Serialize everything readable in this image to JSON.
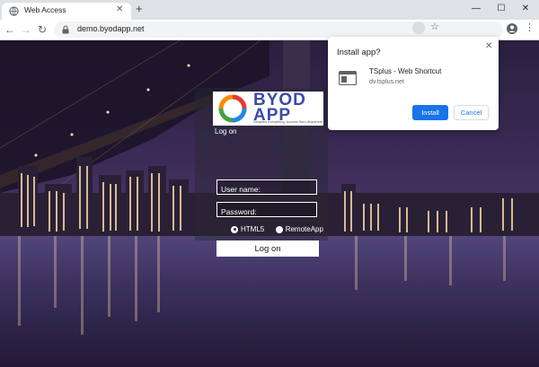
{
  "browser": {
    "tab_title": "Web Access",
    "url": "demo.byodapp.net"
  },
  "install_popup": {
    "title": "Install app?",
    "app_name": "TSplus - Web Shortcut",
    "app_url": "dv.tsplus.net",
    "install_label": "Install",
    "cancel_label": "Cancel"
  },
  "login": {
    "logo_text": "BYOD APP",
    "logo_tagline": "Simplies everything. Access from Anywhere",
    "section_label": "Log on",
    "username_placeholder": "User name:",
    "password_placeholder": "Password:",
    "mode_options": [
      "HTML5",
      "RemoteApp"
    ],
    "selected_mode": "HTML5",
    "submit_label": "Log on"
  },
  "colors": {
    "accent": "#1a73e8",
    "logo_blue": "#3b4aa8"
  }
}
